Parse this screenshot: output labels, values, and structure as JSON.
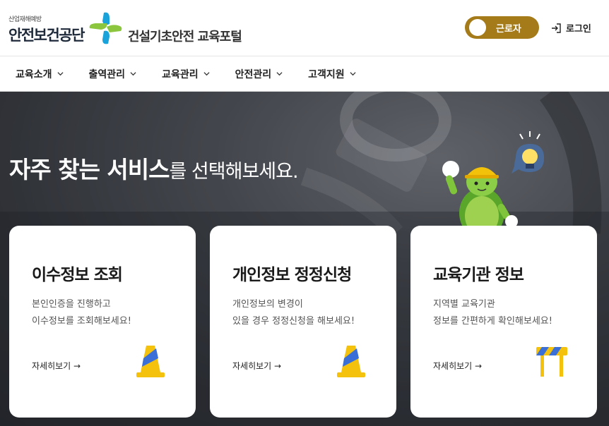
{
  "header": {
    "logo_sub": "산업재해예방",
    "logo_main": "안전보건공단",
    "portal_name": "건설기초안전 교육포털",
    "worker_toggle": "근로자",
    "login": "로그인"
  },
  "nav": {
    "items": [
      "교육소개",
      "출역관리",
      "교육관리",
      "안전관리",
      "고객지원"
    ]
  },
  "hero": {
    "title_strong": "자주 찾는 서비스",
    "title_rest": "를 선택해보세요."
  },
  "cards": [
    {
      "title": "이수정보 조회",
      "desc_line1": "본인인증을 진행하고",
      "desc_line2": "이수정보를 조회해보세요!",
      "link": "자세히보기 →",
      "icon": "traffic-cone-icon"
    },
    {
      "title": "개인정보 정정신청",
      "desc_line1": "개인정보의 변경이",
      "desc_line2": "있을 경우 정정신청을 해보세요!",
      "link": "자세히보기 →",
      "icon": "traffic-cone-icon"
    },
    {
      "title": "교육기관 정보",
      "desc_line1": "지역별 교육기관",
      "desc_line2": "정보를 간편하게 확인해보세요!",
      "link": "자세히보기 →",
      "icon": "barricade-icon"
    }
  ],
  "colors": {
    "toggle": "#a57b1a",
    "logo_green": "#8cc63f",
    "logo_blue": "#1aa3db",
    "cone_yellow": "#f4c20d",
    "cone_blue": "#3a6fd8"
  }
}
